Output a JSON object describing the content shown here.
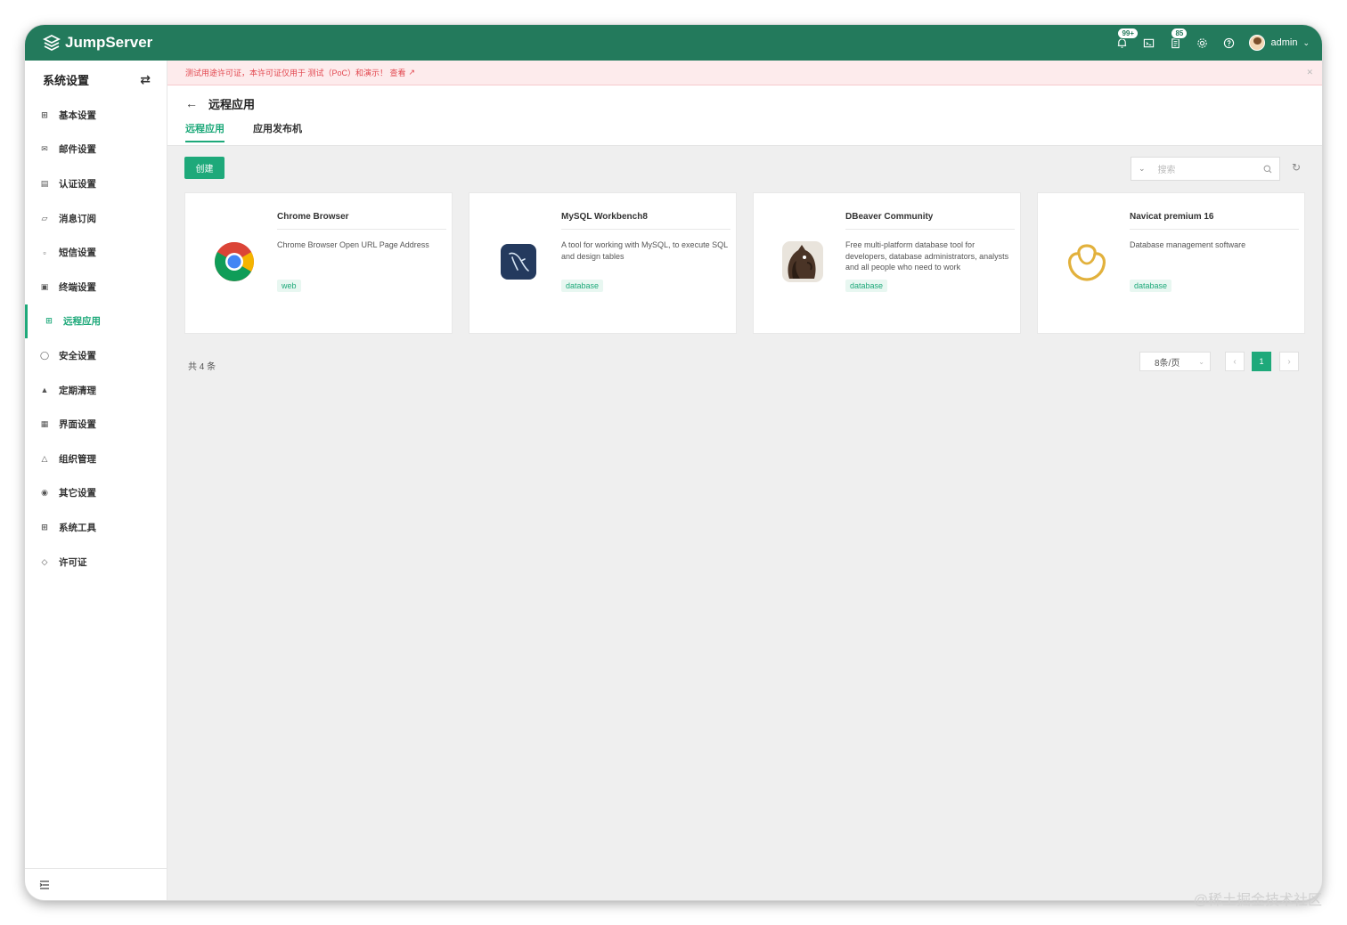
{
  "header": {
    "brand": "JumpServer",
    "notifications_badge": "99+",
    "tasks_badge": "85",
    "user_name": "admin"
  },
  "sidebar": {
    "title": "系统设置",
    "items": [
      {
        "label": "基本设置",
        "icon": "grid-icon"
      },
      {
        "label": "邮件设置",
        "icon": "mail-icon"
      },
      {
        "label": "认证设置",
        "icon": "id-card-icon"
      },
      {
        "label": "消息订阅",
        "icon": "bell-icon"
      },
      {
        "label": "短信设置",
        "icon": "sms-icon"
      },
      {
        "label": "终端设置",
        "icon": "terminal-icon"
      },
      {
        "label": "远程应用",
        "icon": "apps-icon"
      },
      {
        "label": "安全设置",
        "icon": "shield-icon"
      },
      {
        "label": "定期清理",
        "icon": "broom-icon"
      },
      {
        "label": "界面设置",
        "icon": "layout-icon"
      },
      {
        "label": "组织管理",
        "icon": "org-icon"
      },
      {
        "label": "其它设置",
        "icon": "settings-icon"
      },
      {
        "label": "系统工具",
        "icon": "tools-icon"
      },
      {
        "label": "许可证",
        "icon": "license-icon"
      }
    ],
    "active_index": 6
  },
  "alert": {
    "text": "测试用途许可证，本许可证仅用于 测试（PoC）和演示！ 查看"
  },
  "page": {
    "title": "远程应用",
    "tabs": [
      "远程应用",
      "应用发布机"
    ],
    "create_label": "创建",
    "search_placeholder": "搜索"
  },
  "cards": [
    {
      "name": "Chrome Browser",
      "description": "Chrome Browser Open URL Page Address",
      "tag": "web",
      "icon": "chrome-icon"
    },
    {
      "name": "MySQL Workbench8",
      "description": "A tool for working with MySQL, to execute SQL and design tables",
      "tag": "database",
      "icon": "mysql-workbench-icon"
    },
    {
      "name": "DBeaver Community",
      "description": "Free multi-platform database tool for developers, database administrators, analysts and all people who need to work",
      "tag": "database",
      "icon": "dbeaver-icon"
    },
    {
      "name": "Navicat premium 16",
      "description": "Database management software",
      "tag": "database",
      "icon": "navicat-icon"
    }
  ],
  "pagination": {
    "total_text": "共 4 条",
    "page_size": "8条/页",
    "current_page": "1"
  },
  "watermark": "@稀土掘金技术社区",
  "colors": {
    "brand": "#237a5c",
    "accent": "#1ea97a",
    "alert_text": "#e2474f"
  }
}
